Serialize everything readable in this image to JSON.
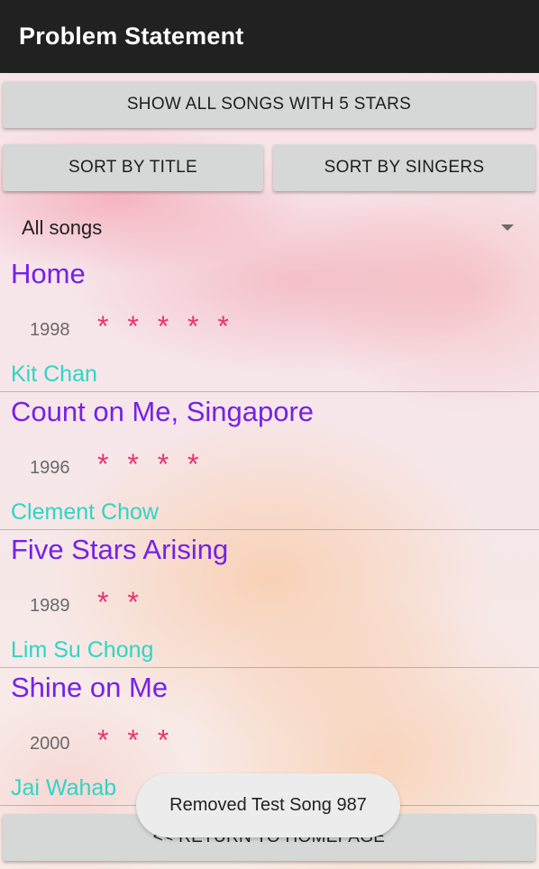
{
  "appbar": {
    "title": "Problem Statement"
  },
  "buttons": {
    "show_all_five_stars": "SHOW ALL SONGS WITH 5 STARS",
    "sort_by_title": "SORT BY TITLE",
    "sort_by_singers": "SORT BY SINGERS",
    "return_home": "<< RETURN TO HOMEPAGE"
  },
  "filter": {
    "selected": "All songs"
  },
  "songs": [
    {
      "title": "Home",
      "year": "1998",
      "stars": "* * * * *",
      "singer": "Kit Chan"
    },
    {
      "title": "Count on Me, Singapore",
      "year": "1996",
      "stars": "* * * *",
      "singer": "Clement Chow"
    },
    {
      "title": "Five Stars Arising",
      "year": "1989",
      "stars": "* *",
      "singer": "Lim Su Chong"
    },
    {
      "title": "Shine on Me",
      "year": "2000",
      "stars": "* * *",
      "singer": "Jai Wahab"
    }
  ],
  "toast": {
    "message": "Removed Test Song 987"
  },
  "colors": {
    "appbar_bg": "#212121",
    "title": "#7621e6",
    "stars": "#e8336f",
    "singer": "#2fd5c4",
    "button_bg": "#d6d7d7"
  }
}
